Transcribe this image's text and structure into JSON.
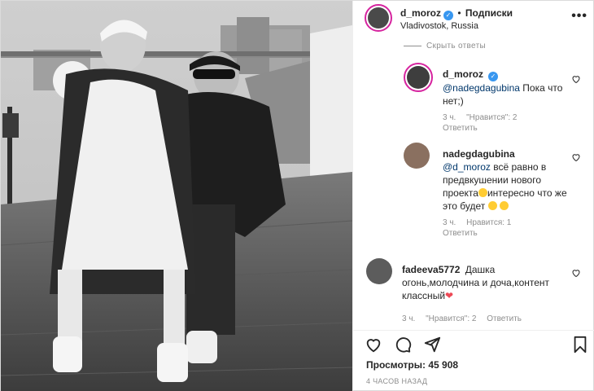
{
  "post": {
    "username": "d_moroz",
    "verified": true,
    "separator": "•",
    "follow_label": "Подписки",
    "location": "Vladivostok, Russia",
    "more_icon": "more-dots-icon"
  },
  "comments": {
    "hide_replies_label": "Скрыть ответы",
    "items": [
      {
        "username": "d_moroz",
        "mention": "@nadegdagubina",
        "text": "Пока что нет;)",
        "time": "3 ч.",
        "likes": "\"Нравится\": 2",
        "reply": "Ответить"
      },
      {
        "username": "nadegdagubina",
        "mention": "@d_moroz",
        "text_part1": "всё равно в предвкушении нового проекта",
        "text_part2": "интересно что же это будет",
        "time": "3 ч.",
        "likes": "Нравится: 1",
        "reply": "Ответить"
      },
      {
        "username": "fadeeva5772",
        "text": "Дашка огонь,молодчина и доча,контент классный",
        "heart": "❤",
        "time": "3 ч.",
        "likes": "\"Нравится\": 2",
        "reply": "Ответить"
      }
    ]
  },
  "actions": {
    "like_icon": "heart-icon",
    "comment_icon": "comment-icon",
    "share_icon": "share-icon",
    "save_icon": "bookmark-icon"
  },
  "views_label": "Просмотры: 45 908",
  "timestamp": "4 ЧАСОВ НАЗАД",
  "colors": {
    "link": "#00376b",
    "muted": "#8e8e8e",
    "verified": "#3897f0",
    "ring": "#d6249f",
    "heart": "#ed4956"
  }
}
